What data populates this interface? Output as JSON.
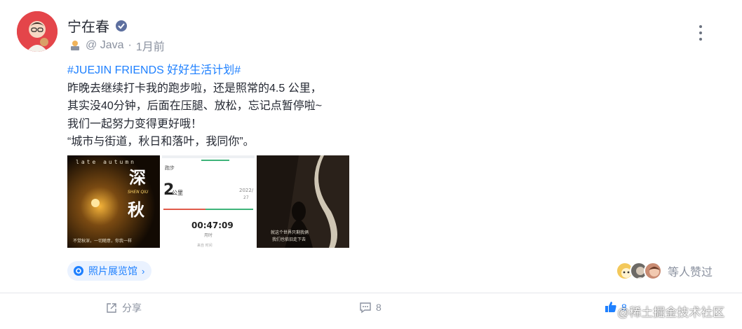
{
  "author": {
    "name": "宁在春",
    "level_icon": "level-badge-icon",
    "circle": "@ Java",
    "separator": "·",
    "time": "1月前"
  },
  "post": {
    "topic": "#JUEJIN FRIENDS 好好生活计划#",
    "lines": [
      "昨晚去继续打卡我的跑步啦，还是照常的4.5 公里，",
      "其实没40分钟，后面在压腿、放松，忘记点暂停啦~",
      "我们一起努力变得更好哦！",
      "“城市与街道，秋日和落叶，我同你”。"
    ]
  },
  "images": {
    "img1": {
      "top_text": "late autumn",
      "char1": "深",
      "char2": "秋",
      "pinyin": "SHEN QIU",
      "caption": "不觉秋深，一切随意，你我一样"
    },
    "img2": {
      "label_top": "跑步",
      "distance": "2",
      "unit": "公里",
      "year": "2022/",
      "small": "27",
      "time": "00:47:09",
      "time_label": "用时",
      "bottom": "来自 时间"
    },
    "img3": {
      "caption1": "就这个世界只剩我俩",
      "caption2": "我们也依旧走下去"
    }
  },
  "gallery": {
    "label": "照片展览馆",
    "chevron": "›"
  },
  "likes": {
    "text": "等人赞过"
  },
  "actions": {
    "share": "分享",
    "comment_count": "8",
    "like_count": "8"
  },
  "watermark": "@稀土掘金技术社区",
  "colors": {
    "accent": "#1e80ff",
    "text": "#252933",
    "muted": "#8a919f"
  }
}
